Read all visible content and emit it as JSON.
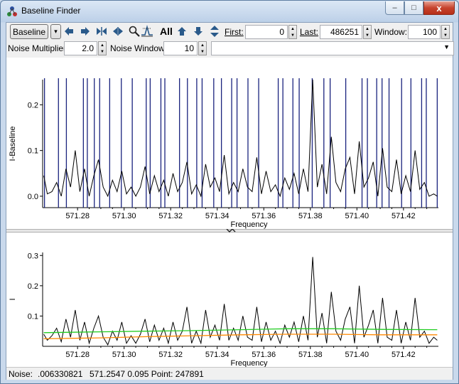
{
  "window": {
    "title": "Baseline Finder",
    "minimize_glyph": "–",
    "maximize_glyph": "□",
    "close_glyph": "x"
  },
  "toolbar": {
    "baseline_button": "Baseline",
    "dropdown_glyph": "▾",
    "icons": [
      "arrow-left-icon",
      "arrow-right-icon",
      "shrink-horizontal-icon",
      "expand-horizontal-icon",
      "zoom-icon",
      "peak-marker-icon"
    ],
    "all_label": "All",
    "first_label": "First:",
    "first_value": "0",
    "last_label": "Last:",
    "last_value": "486251",
    "window_label": "Window:",
    "window_value": "100"
  },
  "noise": {
    "multiplier_label": "Noise Multiplier:",
    "multiplier_value": "2.0",
    "window_label": "Noise Window:",
    "window_value": "10",
    "combo_value": ""
  },
  "top_plot": {
    "ylabel": "I-Baseline",
    "xlabel": "Frequency",
    "yticks": [
      "0.2",
      "0.1",
      "0.0"
    ],
    "xticks": [
      "571.28",
      "571.30",
      "571.32",
      "571.34",
      "571.36",
      "571.38",
      "571.40",
      "571.42"
    ]
  },
  "bottom_plot": {
    "ylabel": "I",
    "xlabel": "Frequency",
    "yticks": [
      "0.3",
      "0.2",
      "0.1"
    ],
    "xticks": [
      "571.28",
      "571.30",
      "571.32",
      "571.34",
      "571.36",
      "571.38",
      "571.40",
      "571.42"
    ]
  },
  "status": {
    "noise_label": "Noise:",
    "noise_value": ".006330821",
    "cursor": "571.2547  0.095 Point: 247891"
  },
  "chart_data": [
    {
      "type": "line",
      "ylabel": "I-Baseline",
      "xlabel": "Frequency",
      "xlim": [
        571.265,
        571.435
      ],
      "ylim": [
        -0.025,
        0.255
      ],
      "series": [
        {
          "color": "#000000",
          "x": [
            571.2655,
            571.267,
            571.269,
            571.271,
            571.273,
            571.275,
            571.277,
            571.279,
            571.281,
            571.283,
            571.285,
            571.287,
            571.289,
            571.291,
            571.293,
            571.295,
            571.297,
            571.299,
            571.301,
            571.303,
            571.305,
            571.307,
            571.309,
            571.311,
            571.313,
            571.315,
            571.317,
            571.319,
            571.321,
            571.323,
            571.325,
            571.327,
            571.329,
            571.331,
            571.333,
            571.335,
            571.337,
            571.339,
            571.341,
            571.343,
            571.345,
            571.347,
            571.349,
            571.351,
            571.353,
            571.355,
            571.357,
            571.359,
            571.361,
            571.363,
            571.365,
            571.367,
            571.369,
            571.371,
            571.373,
            571.375,
            571.377,
            571.379,
            571.381,
            571.383,
            571.385,
            571.387,
            571.389,
            571.391,
            571.393,
            571.395,
            571.397,
            571.399,
            571.401,
            571.403,
            571.405,
            571.407,
            571.409,
            571.411,
            571.413,
            571.415,
            571.417,
            571.419,
            571.421,
            571.423,
            571.425,
            571.427,
            571.429,
            571.431,
            571.433,
            571.4345
          ],
          "y": [
            0.045,
            0.005,
            0.01,
            0.03,
            0.0,
            0.06,
            0.02,
            0.1,
            0.01,
            0.06,
            0.0,
            0.045,
            0.08,
            0.02,
            0.0,
            0.035,
            0.01,
            0.055,
            0.005,
            0.02,
            0.0,
            0.02,
            0.065,
            0.005,
            0.045,
            0.01,
            0.035,
            0.0,
            0.05,
            0.01,
            0.03,
            0.075,
            0.005,
            0.025,
            0.0,
            0.07,
            0.02,
            0.04,
            0.01,
            0.09,
            0.005,
            0.03,
            0.01,
            0.06,
            0.02,
            0.01,
            0.085,
            0.005,
            0.055,
            0.01,
            0.025,
            0.0,
            0.04,
            0.015,
            0.05,
            0.005,
            0.06,
            0.01,
            0.255,
            0.02,
            0.07,
            0.005,
            0.13,
            0.03,
            0.01,
            0.06,
            0.085,
            0.005,
            0.12,
            0.02,
            0.04,
            0.075,
            0.0,
            0.105,
            0.02,
            0.01,
            0.08,
            0.005,
            0.045,
            0.01,
            0.1,
            0.015,
            0.03,
            0.0,
            0.005,
            0.0
          ]
        }
      ],
      "vlines": [
        571.2658,
        571.2718,
        571.2752,
        571.2825,
        571.2842,
        571.2872,
        571.2895,
        571.2938,
        571.2988,
        571.3035,
        571.3095,
        571.3112,
        571.3158,
        571.3175,
        571.3238,
        571.3272,
        571.3312,
        571.3335,
        571.3385,
        571.3418,
        571.3462,
        571.3485,
        571.3532,
        571.3578,
        571.3662,
        571.3682,
        571.3725,
        571.3752,
        571.3808,
        571.3858,
        571.3885,
        571.3952,
        571.4022,
        571.4045,
        571.4085,
        571.4108,
        571.4138,
        571.4192,
        571.4232,
        571.4278,
        571.4298,
        571.4345
      ]
    },
    {
      "type": "line",
      "ylabel": "I",
      "xlabel": "Frequency",
      "xlim": [
        571.265,
        571.435
      ],
      "ylim": [
        0.0,
        0.31
      ],
      "series": [
        {
          "color": "#000000",
          "x": [
            571.2655,
            571.267,
            571.269,
            571.271,
            571.273,
            571.275,
            571.277,
            571.279,
            571.281,
            571.283,
            571.285,
            571.287,
            571.289,
            571.291,
            571.293,
            571.295,
            571.297,
            571.299,
            571.301,
            571.303,
            571.305,
            571.307,
            571.309,
            571.311,
            571.313,
            571.315,
            571.317,
            571.319,
            571.321,
            571.323,
            571.325,
            571.327,
            571.329,
            571.331,
            571.333,
            571.335,
            571.337,
            571.339,
            571.341,
            571.343,
            571.345,
            571.347,
            571.349,
            571.351,
            571.353,
            571.355,
            571.357,
            571.359,
            571.361,
            571.363,
            571.365,
            571.367,
            571.369,
            571.371,
            571.373,
            571.375,
            571.377,
            571.379,
            571.381,
            571.383,
            571.385,
            571.387,
            571.389,
            571.391,
            571.393,
            571.395,
            571.397,
            571.399,
            571.401,
            571.403,
            571.405,
            571.407,
            571.409,
            571.411,
            571.413,
            571.415,
            571.417,
            571.419,
            571.421,
            571.423,
            571.425,
            571.427,
            571.429,
            571.431,
            571.433,
            571.4345
          ],
          "y": [
            0.04,
            0.02,
            0.035,
            0.06,
            0.015,
            0.09,
            0.03,
            0.12,
            0.02,
            0.08,
            0.01,
            0.06,
            0.1,
            0.03,
            0.005,
            0.05,
            0.02,
            0.08,
            0.01,
            0.035,
            0.01,
            0.04,
            0.09,
            0.015,
            0.07,
            0.02,
            0.06,
            0.01,
            0.08,
            0.02,
            0.05,
            0.13,
            0.01,
            0.05,
            0.01,
            0.12,
            0.03,
            0.07,
            0.02,
            0.14,
            0.02,
            0.06,
            0.02,
            0.1,
            0.03,
            0.02,
            0.13,
            0.015,
            0.08,
            0.02,
            0.05,
            0.01,
            0.07,
            0.03,
            0.08,
            0.015,
            0.1,
            0.02,
            0.295,
            0.03,
            0.11,
            0.01,
            0.18,
            0.05,
            0.02,
            0.09,
            0.13,
            0.01,
            0.2,
            0.03,
            0.07,
            0.12,
            0.01,
            0.16,
            0.03,
            0.02,
            0.12,
            0.01,
            0.08,
            0.02,
            0.16,
            0.03,
            0.05,
            0.01,
            0.03,
            0.02
          ]
        },
        {
          "color": "#22cc22",
          "x": [
            571.2655,
            571.29,
            571.31,
            571.33,
            571.35,
            571.37,
            571.39,
            571.41,
            571.4345
          ],
          "y": [
            0.045,
            0.048,
            0.05,
            0.052,
            0.055,
            0.058,
            0.058,
            0.056,
            0.055
          ]
        },
        {
          "color": "#ff8800",
          "x": [
            571.2655,
            571.29,
            571.31,
            571.33,
            571.35,
            571.37,
            571.39,
            571.41,
            571.4345
          ],
          "y": [
            0.025,
            0.028,
            0.032,
            0.035,
            0.038,
            0.04,
            0.04,
            0.038,
            0.038
          ]
        }
      ]
    }
  ]
}
